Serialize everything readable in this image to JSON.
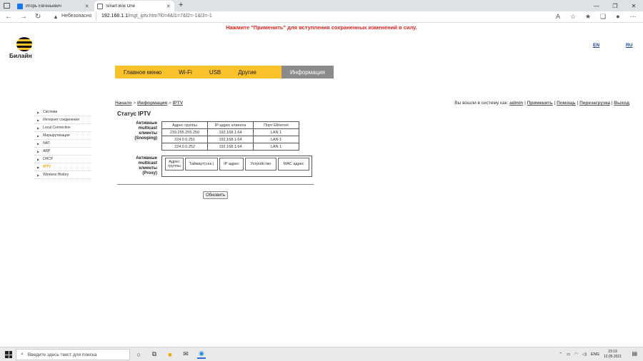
{
  "browser": {
    "tabs": [
      {
        "title": "Игорь Евгеньевич",
        "close": "✕"
      },
      {
        "title": "Smart Box One",
        "close": "✕"
      }
    ],
    "new_tab": "+",
    "window_controls": [
      "—",
      "❐",
      "✕"
    ],
    "security_warning": "Небезопасно",
    "url_host": "192.168.1.1",
    "url_path": "/mgt_iptv.htm?l0=4&l1=7&l2=-1&l3=-1"
  },
  "page": {
    "notice": "Нажмите \"Применить\" для вступления сохраненных изменений в силу.",
    "logo_text": "Билайн",
    "lang_en": "EN",
    "lang_ru": "RU",
    "menu": [
      "Главное меню",
      "Wi-Fi",
      "USB",
      "Другие",
      "Информация"
    ],
    "breadcrumb": {
      "home": "Начало",
      "sep": " > ",
      "section": "Информация",
      "page": "IPTV"
    },
    "userbar": {
      "prefix": "Вы вошли в систему как: ",
      "user": "admin",
      "apply": "Применить",
      "help": "Помощь",
      "reboot": "Перезагрузка",
      "logout": "Выход"
    },
    "sidebar": [
      "Система",
      "Интернет соединения",
      "Local Connection",
      "Маршрутизация",
      "NAT",
      "ARP",
      "DHCP",
      "IPTV",
      "Wireless History"
    ],
    "title": "Статус IPTV",
    "snooping": {
      "label": [
        "Активные",
        "multicast",
        "клиенты",
        "(Snooping)"
      ],
      "headers": [
        "Адрес группы",
        "IP адрес клиента",
        "Порт Ethernet"
      ],
      "rows": [
        [
          "239.255.255.250",
          "192.168.1.64",
          "LAN 1"
        ],
        [
          "224.0.0.251",
          "192.168.1.64",
          "LAN 1"
        ],
        [
          "224.0.0.252",
          "192.168.1.64",
          "LAN 1"
        ]
      ]
    },
    "proxy": {
      "label": [
        "Активные",
        "multicast",
        "клиенты",
        "(Proxy)"
      ],
      "headers": [
        "Адрес группы",
        "Тайм­аут(сек.)",
        "IP адрес",
        "Устройство",
        "MAC адрес"
      ]
    },
    "refresh_button": "Обновить"
  },
  "taskbar": {
    "search_placeholder": "Введите здесь текст для поиска",
    "lang": "ENG",
    "time": "23:19",
    "date": "12.05.2021"
  }
}
